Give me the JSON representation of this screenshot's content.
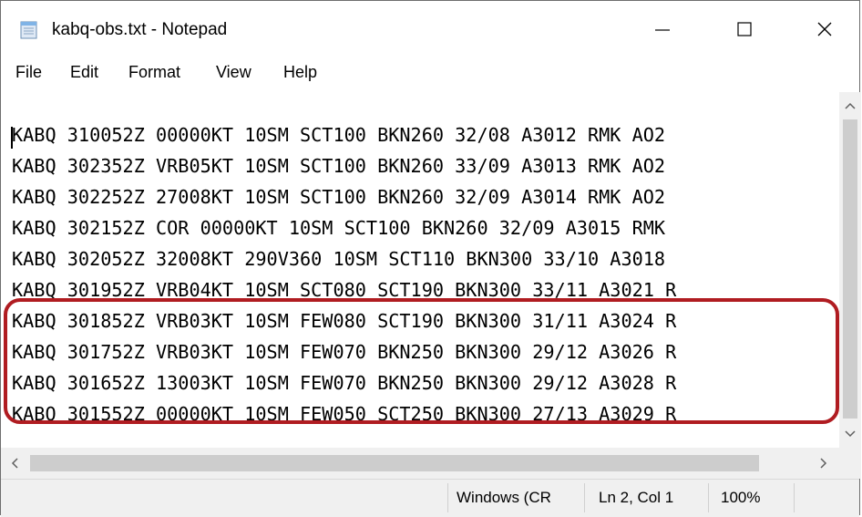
{
  "window": {
    "title": "kabq-obs.txt - Notepad",
    "controls": {
      "minimize": "—",
      "maximize": "☐",
      "close": "✕"
    }
  },
  "menu": [
    "File",
    "Edit",
    "Format",
    "View",
    "Help"
  ],
  "document": {
    "lines": [
      "KABQ 310052Z 00000KT 10SM SCT100 BKN260 32/08 A3012 RMK AO2",
      "KABQ 302352Z VRB05KT 10SM SCT100 BKN260 33/09 A3013 RMK AO2",
      "KABQ 302252Z 27008KT 10SM SCT100 BKN260 32/09 A3014 RMK AO2",
      "KABQ 302152Z COR 00000KT 10SM SCT100 BKN260 32/09 A3015 RMK",
      "KABQ 302052Z 32008KT 290V360 10SM SCT110 BKN300 33/10 A3018",
      "KABQ 301952Z VRB04KT 10SM SCT080 SCT190 BKN300 33/11 A3021 R",
      "KABQ 301852Z VRB03KT 10SM FEW080 SCT190 BKN300 31/11 A3024 R",
      "KABQ 301752Z VRB03KT 10SM FEW070 BKN250 BKN300 29/12 A3026 R",
      "KABQ 301652Z 13003KT 10SM FEW070 BKN250 BKN300 29/12 A3028 R",
      "KABQ 301552Z 00000KT 10SM FEW050 SCT250 BKN300 27/13 A3029 R"
    ]
  },
  "status": {
    "encoding": "Windows (CR",
    "position": "Ln 2, Col 1",
    "zoom": "100%"
  },
  "colors": {
    "highlight_border": "#b01c21"
  }
}
